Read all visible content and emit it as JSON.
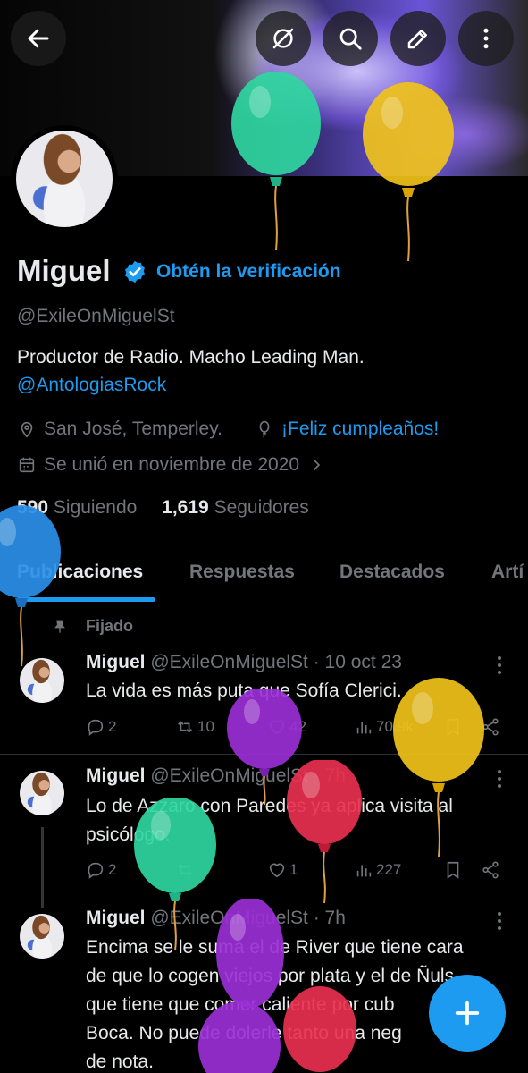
{
  "header": {
    "buttons": [
      "back",
      "no-translate",
      "search",
      "edit",
      "more"
    ]
  },
  "profile": {
    "name": "Miguel",
    "verify_label": "Obtén la verificación",
    "handle": "@ExileOnMiguelSt",
    "bio_line1": "Productor de Radio. Macho Leading Man.",
    "bio_mention": "@AntologiasRock",
    "location": "San José, Temperley.",
    "birthday": "¡Feliz cumpleaños!",
    "joined": "Se unió en noviembre de 2020",
    "following_count": "590",
    "following_label": "Siguiendo",
    "followers_count": "1,619",
    "followers_label": "Seguidores"
  },
  "tabs": [
    "Publicaciones",
    "Respuestas",
    "Destacados",
    "Artí"
  ],
  "pinned_label": "Fijado",
  "tweets": [
    {
      "name": "Miguel",
      "meta": "@ExileOnMiguelSt · 10 oct 23",
      "text": "La vida es más puta que Sofía Clerici.",
      "replies": "2",
      "retweets": "10",
      "likes": "42",
      "views": "70.9k"
    },
    {
      "name": "Miguel",
      "meta": "@ExileOnMiguelSt · 7h",
      "text": "Lo de Azzaro con Paredes ya aplica visita al psicólogo.",
      "replies": "2",
      "retweets": "",
      "likes": "1",
      "views": "227"
    },
    {
      "name": "Miguel",
      "meta": "@ExileOnMiguelSt · 7h",
      "text_lines": [
        "Encima se le suma el de River que tiene cara",
        "de que lo cogen viejos por plata y el de Ñuls",
        "que tiene que comer caliente por cub",
        "Boca. No puede dolerle tanto una neg",
        "de nota."
      ]
    }
  ],
  "colors": {
    "accent": "#1d9bf0",
    "muted": "#71767b",
    "text": "#e7e9ea",
    "background": "#000000",
    "balloon_green": "#2fd6a0",
    "balloon_yellow": "#f0c21a",
    "balloon_blue": "#2a8fe8",
    "balloon_purple": "#9a2fd6",
    "balloon_red": "#e8304f"
  },
  "fab_icon": "plus-icon"
}
